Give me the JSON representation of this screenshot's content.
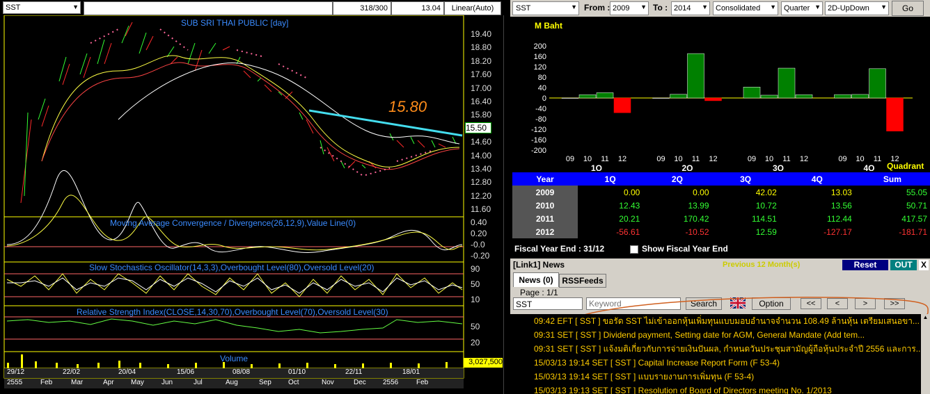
{
  "left": {
    "symbol": "SST",
    "count": "318/300",
    "price": "13.04",
    "scale": "Linear(Auto)",
    "chart_title": "SUB SRI THAI PUBLIC [day]",
    "annotation": "15.80",
    "price_tag": "15.50",
    "price_axis": [
      "19.40",
      "18.80",
      "18.20",
      "17.60",
      "17.00",
      "16.40",
      "15.80",
      "15.20",
      "14.60",
      "14.00",
      "13.40",
      "12.80",
      "12.20",
      "11.60"
    ],
    "macd_title": "Moving Average Convergence / Divergence(26,12,9),Value Line(0)",
    "macd_axis": [
      "0.40",
      "0.20",
      "-0.0",
      "-0.20"
    ],
    "stoch_title": "Slow Stochastics Oscillator(14,3,3),Overbought Level(80),Oversold Level(20)",
    "stoch_axis": [
      "90",
      "50",
      "10"
    ],
    "rsi_title": "Relative Strength Index(CLOSE,14,30,70),Overbought Level(70),Oversold Level(30)",
    "rsi_axis": [
      "50",
      "20"
    ],
    "volume_title": "Volume",
    "volume_value": "3,027,500",
    "date_labels": [
      "29/12",
      "22/02",
      "20/04",
      "15/06",
      "08/08",
      "01/10",
      "22/11",
      "18/01"
    ],
    "month_labels": [
      "2555",
      "Feb",
      "Mar",
      "Apr",
      "May",
      "Jun",
      "Jul",
      "Aug",
      "Sep",
      "Oct",
      "Nov",
      "Dec",
      "2556",
      "Feb"
    ]
  },
  "right": {
    "symbol": "SST",
    "from_label": "From :",
    "from_value": "2009",
    "to_label": "To :",
    "to_value": "2014",
    "mode": "Consolidated",
    "period": "Quarter",
    "view": "2D-UpDown",
    "go": "Go",
    "chart_unit": "M Baht",
    "year_sub": [
      "09",
      "10",
      "11",
      "12"
    ],
    "quadrant_label": "Quadrant",
    "table": {
      "headers": [
        "Year",
        "1Q",
        "2Q",
        "3Q",
        "4Q",
        "Sum"
      ],
      "rows": [
        {
          "year": "2009",
          "q1": "0.00",
          "q2": "0.00",
          "q3": "42.02",
          "q4": "13.03",
          "sum": "55.05"
        },
        {
          "year": "2010",
          "q1": "12.43",
          "q2": "13.99",
          "q3": "10.72",
          "q4": "13.56",
          "sum": "50.71"
        },
        {
          "year": "2011",
          "q1": "20.21",
          "q2": "170.42",
          "q3": "114.51",
          "q4": "112.44",
          "sum": "417.57"
        },
        {
          "year": "2012",
          "q1": "-56.61",
          "q2": "-10.52",
          "q3": "12.59",
          "q4": "-127.17",
          "sum": "-181.71"
        }
      ]
    },
    "fiscal_label": "Fiscal  Year  End",
    "fiscal_value": ":  31/12",
    "show_fiscal": "Show Fiscal Year End",
    "news_title": "[Link1] News",
    "news_previous": "Previous 12 Month(s)",
    "reset": "Reset",
    "out": "OUT",
    "close": "X",
    "tab_news": "News (0)",
    "tab_rss": "RSSFeeds",
    "page": "Page : 1/1",
    "search_symbol": "SST",
    "keyword_placeholder": "Keyword",
    "search_btn": "Search",
    "option_btn": "Option",
    "nav": [
      "<<",
      "<",
      ">",
      ">>"
    ],
    "news": [
      "09:42  EFT  [ SST ]  ขอรัด SST ไม่เข้าออกหุ้นเพิ่มทุนแบบมอบอำนาจจำนวน 108.49 ล้านหุ้น เตรียมเสนอขา...",
      "09:31  SET  [ SST ]  Dividend payment, Setting date for AGM, General Mandate (Add tem...",
      "09:31  SET  [ SST ]  แจ้งมติเกี่ยวกับการจ่ายเงินปันผล, กำหนดวันประชุมสามัญผู้ถือหุ้นประจำปี 2556 และการ...",
      "15/03/13 19:14  SET  [ SST ]  Capital Increase Report Form (F 53-4)",
      "15/03/13 19:14  SET  [ SST ]  แบบรายงานการเพิ่มทุน (F 53-4)",
      "15/03/13 19:13  SET  [ SST ]  Resolution of Board of Directors  meeting No. 1/2013"
    ]
  },
  "chart_data": {
    "type": "bar",
    "categories": [
      "09",
      "10",
      "11",
      "12"
    ],
    "series": [
      {
        "name": "1Q",
        "values": [
          0.0,
          12.43,
          20.21,
          -56.61
        ]
      },
      {
        "name": "2Q",
        "values": [
          0.0,
          13.99,
          170.42,
          -10.52
        ]
      },
      {
        "name": "3Q",
        "values": [
          42.02,
          10.72,
          114.51,
          12.59
        ]
      },
      {
        "name": "4Q",
        "values": [
          13.03,
          13.56,
          112.44,
          -127.17
        ]
      }
    ],
    "ylabel": "M Baht",
    "ylim": [
      -200,
      200
    ],
    "yticks": [
      "200",
      "160",
      "120",
      "80",
      "40",
      "0",
      "-40",
      "-80",
      "-120",
      "-160",
      "-200"
    ],
    "colors": {
      "positive": "#008000",
      "negative": "#ff0000",
      "zero_line": "#ffff00"
    }
  }
}
